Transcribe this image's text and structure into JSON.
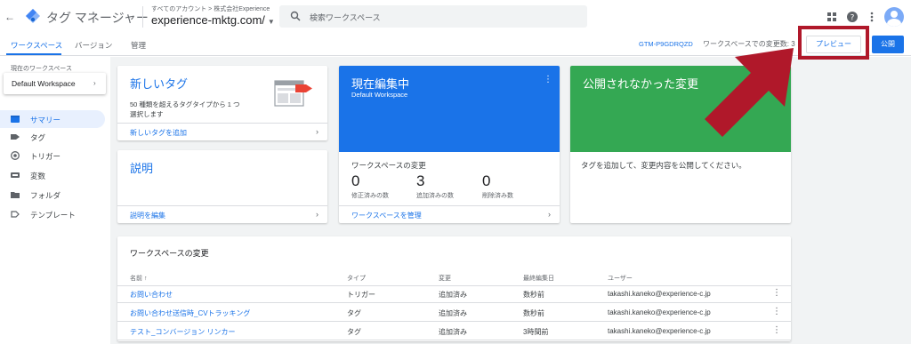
{
  "header": {
    "app_name": "タグ マネージャー",
    "breadcrumb": "すべてのアカウント > 株式会社Experience",
    "container_name": "experience-mktg.com/",
    "search_placeholder": "検索ワークスペース"
  },
  "nav": {
    "tabs": [
      {
        "label": "ワークスペース"
      },
      {
        "label": "バージョン"
      },
      {
        "label": "管理"
      }
    ],
    "container_id": "GTM-P9GDRQZD",
    "workspace_changes": "ワークスペースでの変更数: 3",
    "preview_label": "プレビュー",
    "publish_label": "公開"
  },
  "sidebar": {
    "current_ws_label": "現在のワークスペース",
    "current_ws_value": "Default Workspace",
    "items": [
      {
        "label": "サマリー",
        "icon": "summary-icon"
      },
      {
        "label": "タグ",
        "icon": "tag-icon"
      },
      {
        "label": "トリガー",
        "icon": "trigger-icon"
      },
      {
        "label": "変数",
        "icon": "variable-icon"
      },
      {
        "label": "フォルダ",
        "icon": "folder-icon"
      },
      {
        "label": "テンプレート",
        "icon": "template-icon"
      }
    ]
  },
  "cards": {
    "new_tag": {
      "title": "新しいタグ",
      "desc": "50 種類を超えるタグタイプから 1 つ選択します",
      "link": "新しいタグを追加"
    },
    "description": {
      "title": "説明",
      "link": "説明を編集"
    },
    "current_edit": {
      "title": "現在編集中",
      "workspace": "Default Workspace",
      "changes_heading": "ワークスペースの変更",
      "stats": [
        {
          "value": "0",
          "caption": "修正済みの数"
        },
        {
          "value": "3",
          "caption": "追加済みの数"
        },
        {
          "value": "0",
          "caption": "削除済み数"
        }
      ],
      "link": "ワークスペースを管理"
    },
    "unpublished": {
      "title": "公開されなかった変更",
      "text": "タグを追加して、変更内容を公開してください。"
    }
  },
  "changes_table": {
    "title": "ワークスペースの変更",
    "columns": [
      "名前 ↑",
      "タイプ",
      "変更",
      "最終編集日",
      "ユーザー"
    ],
    "rows": [
      {
        "name": "お問い合わせ",
        "type": "トリガー",
        "change": "追加済み",
        "edited": "数秒前",
        "user": "takashi.kaneko@experience-c.jp"
      },
      {
        "name": "お問い合わせ送信時_CVトラッキング",
        "type": "タグ",
        "change": "追加済み",
        "edited": "数秒前",
        "user": "takashi.kaneko@experience-c.jp"
      },
      {
        "name": "テスト_コンバージョン リンカー",
        "type": "タグ",
        "change": "追加済み",
        "edited": "3時間前",
        "user": "takashi.kaneko@experience-c.jp"
      }
    ]
  },
  "colors": {
    "accent": "#1a73e8",
    "current_edit_card": "#1a73e8",
    "unpublished_card": "#34a853",
    "annotation": "#b0182a"
  }
}
